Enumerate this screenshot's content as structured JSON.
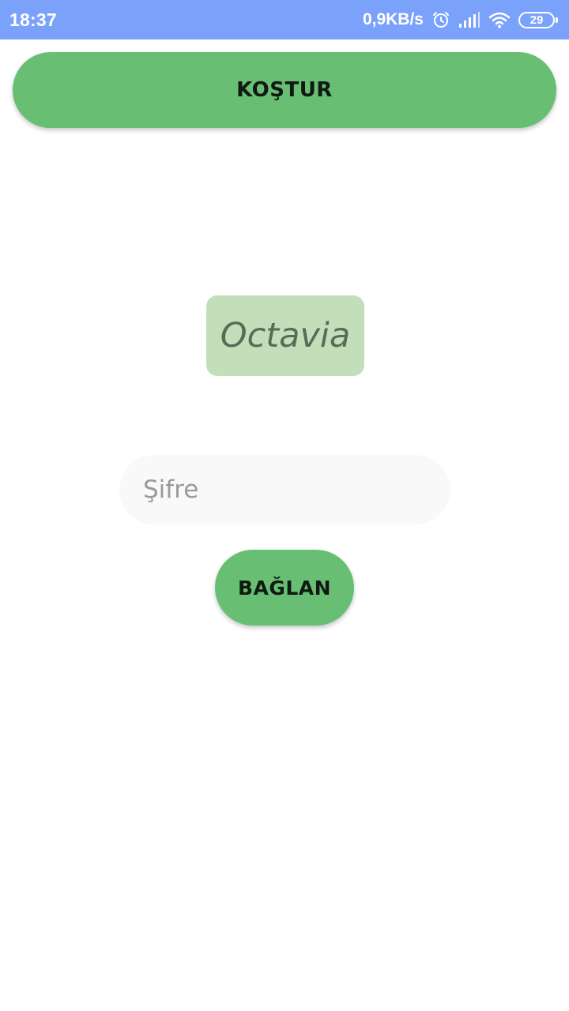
{
  "status_bar": {
    "time": "18:37",
    "network_speed": "0,9KB/s",
    "battery_level": "29",
    "icons": [
      "alarm-icon",
      "signal-icon",
      "wifi-icon",
      "battery-icon"
    ]
  },
  "top_button": {
    "label": "KOŞTUR"
  },
  "logo": {
    "text": "Octavia"
  },
  "password": {
    "placeholder": "Şifre",
    "value": ""
  },
  "connect_button": {
    "label": "BAĞLAN"
  },
  "colors": {
    "status_bar": "#7ba2fb",
    "primary_green": "#68bf73",
    "logo_bg": "#c3dfba",
    "input_bg": "#f9f9f9"
  }
}
